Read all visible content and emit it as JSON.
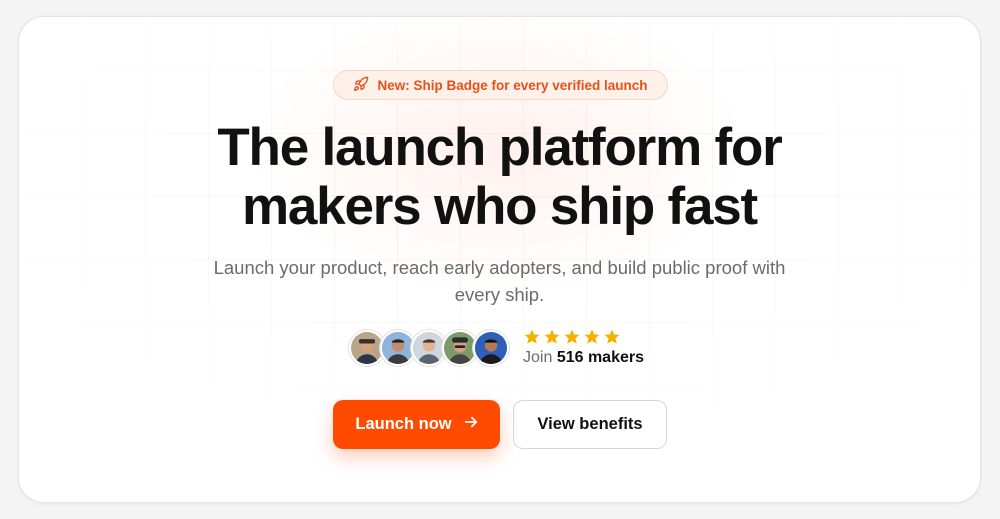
{
  "badge": {
    "icon": "rocket-icon",
    "text": "New: Ship Badge for every verified launch"
  },
  "hero": {
    "headline_line1": "The launch platform for",
    "headline_line2": "makers who ship fast",
    "subtitle_line1": "Launch your product, reach early adopters, and build public proof with",
    "subtitle_line2": "every ship."
  },
  "social_proof": {
    "avatars": [
      "maker-avatar",
      "maker-avatar",
      "maker-avatar",
      "maker-avatar",
      "maker-avatar"
    ],
    "rating_stars": 5,
    "join_prefix": "Join",
    "join_count": "516 makers"
  },
  "actions": {
    "primary_label": "Launch now",
    "primary_icon": "arrow-right-icon",
    "secondary_label": "View benefits"
  },
  "colors": {
    "accent": "#ff4b00",
    "badge_text": "#e8501a",
    "star": "#f6b100",
    "heading": "#111111",
    "muted": "#6b6b6b"
  }
}
